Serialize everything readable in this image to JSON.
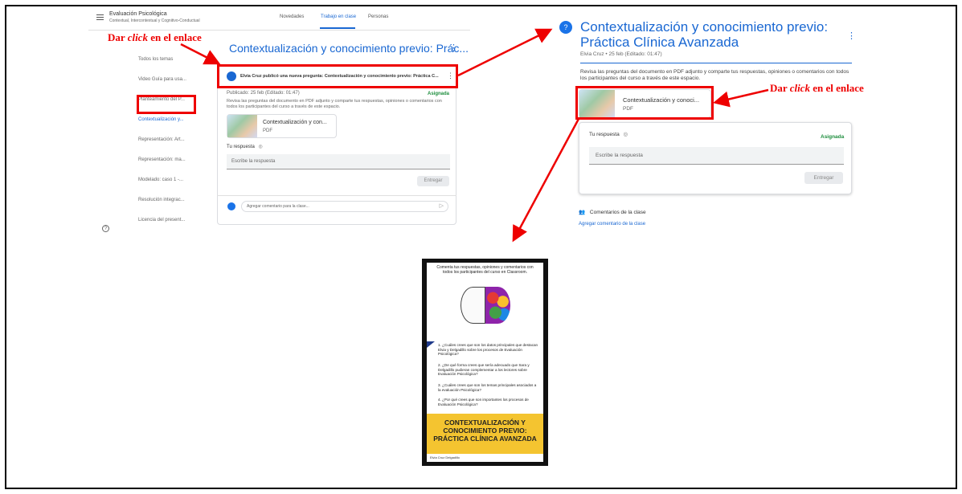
{
  "annotation": {
    "label_prefix": "Dar",
    "label_click": "click",
    "label_suffix": "en el enlace"
  },
  "left_screen": {
    "menu_icon": "menu-icon",
    "course_title": "Evaluación Psicológica",
    "course_subtitle": "Contextual, Intercontextual y Cognitivo-Conductual",
    "tabs": [
      "Novedades",
      "Trabajo en clase",
      "Personas"
    ],
    "active_tab": "Trabajo en clase",
    "topics": [
      "Todos los temas",
      "Video Guía para usa...",
      "Planteamiento del P...",
      "Contextualización y...",
      "Representación: Art...",
      "Representación: ma...",
      "Modelado: caso 1 -...",
      "Resolución integrac...",
      "Licencia del present..."
    ],
    "active_topic": "Contextualización y...",
    "header_title": "Contextualización y conocimiento previo: Prác...",
    "post_text": "Elvia Cruz publicó una nueva pregunta: Contextualización y conocimiento previo: Práctica C...",
    "published": "Publicado: 25 feb (Editado: 01:47)",
    "status": "Asignada",
    "description": "Revisa las preguntas del documento en PDF adjunto y comparte tus respuestas, opiniones o comentarios con todos los participantes del curso a través de este espacio.",
    "attachment_name": "Contextualización y con...",
    "attachment_type": "PDF",
    "answer_label": "Tu respuesta",
    "answer_placeholder": "Escribe la respuesta",
    "submit": "Entregar",
    "comment_placeholder": "Agregar comentario para la clase...",
    "help_icon": "help-icon"
  },
  "right_screen": {
    "title_line1": "Contextualización y conocimiento previo:",
    "title_line2": "Práctica Clínica Avanzada",
    "meta": "Elvia Cruz • 25 feb (Editado: 01:47)",
    "description": "Revisa las preguntas del documento en PDF adjunto y comparte tus respuestas, opiniones o comentarios con todos los participantes del curso a través de este espacio.",
    "attachment_name": "Contextualización y conoci...",
    "attachment_type": "PDF",
    "answer_label": "Tu respuesta",
    "status": "Asignada",
    "answer_placeholder": "Escribe la respuesta",
    "submit": "Entregar",
    "comments_label": "Comentarios de la clase",
    "add_comment": "Agregar comentario de la clase"
  },
  "pdf_preview": {
    "intro": "Comenta tus respuestas, opiniones y comentarios con todos los participantes del curso en Classroom.",
    "questions": [
      "1. ¿Cuáles crees que son los datos principales que destacan Elvia y Delgadillo sobre los procesos de Evaluación Psicológica?",
      "2. ¿De qué forma crees que sería adecuado que Sara y Delgadillo pudieran complementar a los lectores sobre Evaluación Psicológica?",
      "3. ¿Cuáles crees que son los temas principales asociados a la evaluación Psicológica?",
      "4. ¿Por qué crees que son importantes los procesos de Evaluación Psicológica?"
    ],
    "banner_line1": "CONTEXTUALIZACIÓN Y",
    "banner_line2": "CONOCIMIENTO PREVIO:",
    "banner_line3": "PRÁCTICA CLÍNICA AVANZADA",
    "footer": "Elvia Cruz Delgadillo"
  },
  "colors": {
    "accent": "#1967d2",
    "annotation": "#e00000",
    "status": "#1e8e3e",
    "banner": "#f4c430"
  }
}
